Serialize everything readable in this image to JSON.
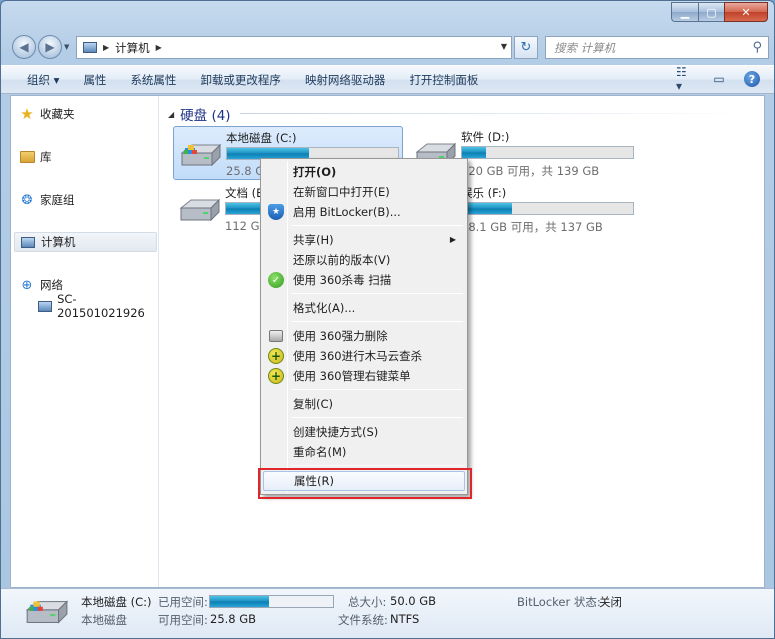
{
  "window": {
    "caption_min": "▁",
    "caption_max": "▢",
    "caption_close": "✕"
  },
  "address": {
    "crumb": "计算机",
    "search_placeholder": "搜索 计算机"
  },
  "toolbar": {
    "items": [
      "组织 ▾",
      "属性",
      "系统属性",
      "卸载或更改程序",
      "映射网络驱动器",
      "打开控制面板"
    ]
  },
  "nav": {
    "favorites": "收藏夹",
    "libraries": "库",
    "homegroup": "家庭组",
    "computer": "计算机",
    "network": "网络",
    "network_pc": "SC-201501021926"
  },
  "group": {
    "title": "硬盘 (4)"
  },
  "drives": [
    {
      "name": "本地磁盘 (C:)",
      "info": "25.8 GB",
      "used_fraction": 0.48
    },
    {
      "name": "软件 (D:)",
      "info": "120 GB 可用，共 139 GB",
      "used_fraction": 0.14
    },
    {
      "name": "文档 (E:)",
      "info": "112 GB",
      "used_fraction": 0.55
    },
    {
      "name": "娱乐 (F:)",
      "info": "98.1 GB 可用，共 137 GB",
      "used_fraction": 0.29
    }
  ],
  "context_menu": {
    "items": [
      {
        "label": "打开(O)",
        "bold": true
      },
      {
        "label": "在新窗口中打开(E)"
      },
      {
        "label": "启用 BitLocker(B)..."
      },
      {
        "label": "共享(H)"
      },
      {
        "label": "还原以前的版本(V)"
      },
      {
        "label": "使用 360杀毒 扫描"
      },
      {
        "label": "格式化(A)..."
      },
      {
        "label": "使用 360强力删除"
      },
      {
        "label": "使用 360进行木马云查杀"
      },
      {
        "label": "使用 360管理右键菜单"
      },
      {
        "label": "复制(C)"
      },
      {
        "label": "创建快捷方式(S)"
      },
      {
        "label": "重命名(M)"
      },
      {
        "label": "属性(R)"
      }
    ]
  },
  "details": {
    "drive_name": "本地磁盘 (C:)",
    "drive_type": "本地磁盘",
    "used_label": "已用空间:",
    "used_fraction": 0.48,
    "free_label": "可用空间:",
    "free_value": "25.8 GB",
    "total_label": "总大小:",
    "total_value": "50.0 GB",
    "fs_label": "文件系统:",
    "fs_value": "NTFS",
    "bitlocker_label": "BitLocker 状态:",
    "bitlocker_value": "关闭"
  },
  "colors": {
    "highlight_box": "#e0252b",
    "group_title": "#1e3287",
    "bar_fill": "#1d8fc0"
  }
}
